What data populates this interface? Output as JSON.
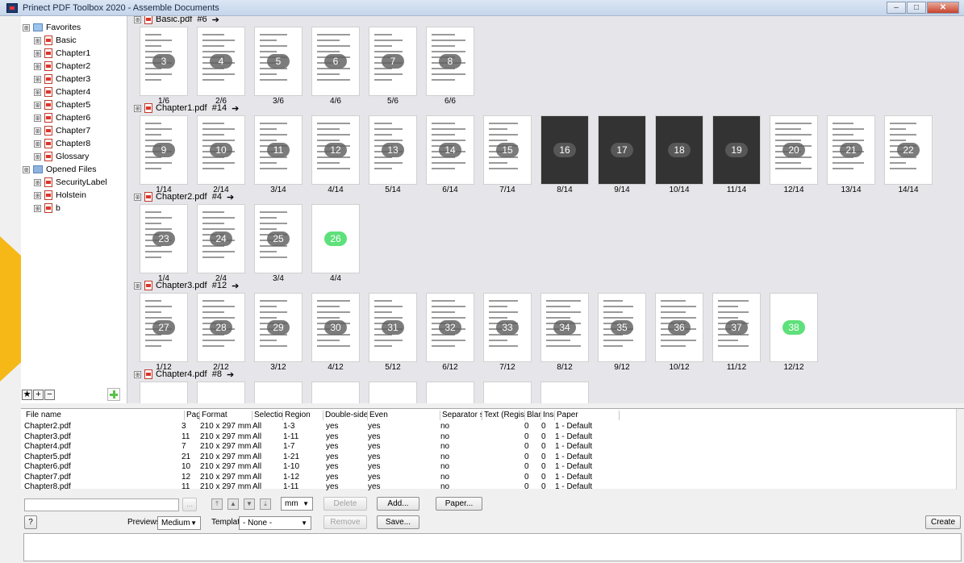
{
  "window": {
    "title": "Prinect PDF Toolbox 2020 - Assemble Documents",
    "minimize": "–",
    "maximize": "□",
    "close": "✕"
  },
  "tree": {
    "items": [
      {
        "label": "Favorites",
        "icon": "folder-icon",
        "indent": 0
      },
      {
        "label": "Basic",
        "icon": "pdf-icon",
        "indent": 1
      },
      {
        "label": "Chapter1",
        "icon": "pdf-icon",
        "indent": 1
      },
      {
        "label": "Chapter2",
        "icon": "pdf-icon",
        "indent": 1
      },
      {
        "label": "Chapter3",
        "icon": "pdf-icon",
        "indent": 1
      },
      {
        "label": "Chapter4",
        "icon": "pdf-icon",
        "indent": 1
      },
      {
        "label": "Chapter5",
        "icon": "pdf-icon",
        "indent": 1
      },
      {
        "label": "Chapter6",
        "icon": "pdf-icon",
        "indent": 1
      },
      {
        "label": "Chapter7",
        "icon": "pdf-icon",
        "indent": 1
      },
      {
        "label": "Chapter8",
        "icon": "pdf-icon",
        "indent": 1
      },
      {
        "label": "Glossary",
        "icon": "pdf-icon",
        "indent": 1
      },
      {
        "label": "Opened Files",
        "icon": "folder-icon",
        "indent": 0
      },
      {
        "label": "SecurityLabel",
        "icon": "pdf-icon",
        "indent": 1
      },
      {
        "label": "Holstein",
        "icon": "pdf-icon",
        "indent": 1
      },
      {
        "label": "b",
        "icon": "pdf-icon",
        "indent": 1
      }
    ],
    "expander": "⊞",
    "buttons": [
      "★",
      "+",
      "−"
    ]
  },
  "groups": [
    {
      "name": "Basic.pdf",
      "count": "#6",
      "pages": [
        {
          "n": "3",
          "label": "1/6"
        },
        {
          "n": "4",
          "label": "2/6"
        },
        {
          "n": "5",
          "label": "3/6"
        },
        {
          "n": "6",
          "label": "4/6"
        },
        {
          "n": "7",
          "label": "5/6"
        },
        {
          "n": "8",
          "label": "6/6"
        }
      ]
    },
    {
      "name": "Chapter1.pdf",
      "count": "#14",
      "pages": [
        {
          "n": "9",
          "label": "1/14"
        },
        {
          "n": "10",
          "label": "2/14"
        },
        {
          "n": "11",
          "label": "3/14"
        },
        {
          "n": "12",
          "label": "4/14"
        },
        {
          "n": "13",
          "label": "5/14"
        },
        {
          "n": "14",
          "label": "6/14"
        },
        {
          "n": "15",
          "label": "7/14"
        },
        {
          "n": "16",
          "label": "8/14"
        },
        {
          "n": "17",
          "label": "9/14"
        },
        {
          "n": "18",
          "label": "10/14"
        },
        {
          "n": "19",
          "label": "11/14"
        },
        {
          "n": "20",
          "label": "12/14"
        },
        {
          "n": "21",
          "label": "13/14"
        },
        {
          "n": "22",
          "label": "14/14"
        }
      ]
    },
    {
      "name": "Chapter2.pdf",
      "count": "#4",
      "pages": [
        {
          "n": "23",
          "label": "1/4"
        },
        {
          "n": "24",
          "label": "2/4"
        },
        {
          "n": "25",
          "label": "3/4"
        },
        {
          "n": "26",
          "label": "4/4",
          "green": true
        }
      ]
    },
    {
      "name": "Chapter3.pdf",
      "count": "#12",
      "pages": [
        {
          "n": "27",
          "label": "1/12"
        },
        {
          "n": "28",
          "label": "2/12"
        },
        {
          "n": "29",
          "label": "3/12"
        },
        {
          "n": "30",
          "label": "4/12"
        },
        {
          "n": "31",
          "label": "5/12"
        },
        {
          "n": "32",
          "label": "6/12"
        },
        {
          "n": "33",
          "label": "7/12"
        },
        {
          "n": "34",
          "label": "8/12"
        },
        {
          "n": "35",
          "label": "9/12"
        },
        {
          "n": "36",
          "label": "10/12"
        },
        {
          "n": "37",
          "label": "11/12"
        },
        {
          "n": "38",
          "label": "12/12",
          "green": true
        }
      ]
    },
    {
      "name": "Chapter4.pdf",
      "count": "#8",
      "pages": []
    }
  ],
  "group_arrow": "➔",
  "table": {
    "columns": [
      "File name",
      "Page",
      "Format",
      "Selection",
      "Region",
      "Double-sided",
      "Even",
      "Separator shee",
      "Text (Register)",
      "Blank",
      "Inser",
      "Paper"
    ],
    "rows": [
      [
        "Chapter2.pdf",
        "3",
        "210 x 297 mm",
        "All",
        "1-3",
        "yes",
        "yes",
        "no",
        "",
        "0",
        "0",
        "1 - Default"
      ],
      [
        "Chapter3.pdf",
        "11",
        "210 x 297 mm",
        "All",
        "1-11",
        "yes",
        "yes",
        "no",
        "",
        "0",
        "0",
        "1 - Default"
      ],
      [
        "Chapter4.pdf",
        "7",
        "210 x 297 mm",
        "All",
        "1-7",
        "yes",
        "yes",
        "no",
        "",
        "0",
        "0",
        "1 - Default"
      ],
      [
        "Chapter5.pdf",
        "21",
        "210 x 297 mm",
        "All",
        "1-21",
        "yes",
        "yes",
        "no",
        "",
        "0",
        "0",
        "1 - Default"
      ],
      [
        "Chapter6.pdf",
        "10",
        "210 x 297 mm",
        "All",
        "1-10",
        "yes",
        "yes",
        "no",
        "",
        "0",
        "0",
        "1 - Default"
      ],
      [
        "Chapter7.pdf",
        "12",
        "210 x 297 mm",
        "All",
        "1-12",
        "yes",
        "yes",
        "no",
        "",
        "0",
        "0",
        "1 - Default"
      ],
      [
        "Chapter8.pdf",
        "11",
        "210 x 297 mm",
        "All",
        "1-11",
        "yes",
        "yes",
        "no",
        "",
        "0",
        "0",
        "1 - Default"
      ]
    ]
  },
  "controls": {
    "browse": "...",
    "unit": "mm",
    "delete": "Delete",
    "add": "Add...",
    "paper": "Paper...",
    "help": "?",
    "previews_label": "Previews",
    "previews_value": "Medium",
    "template_label": "Template",
    "template_value": "- None -",
    "remove": "Remove",
    "save": "Save...",
    "create": "Create",
    "move_icons": [
      "⤒",
      "▲",
      "▼",
      "⤓"
    ]
  }
}
